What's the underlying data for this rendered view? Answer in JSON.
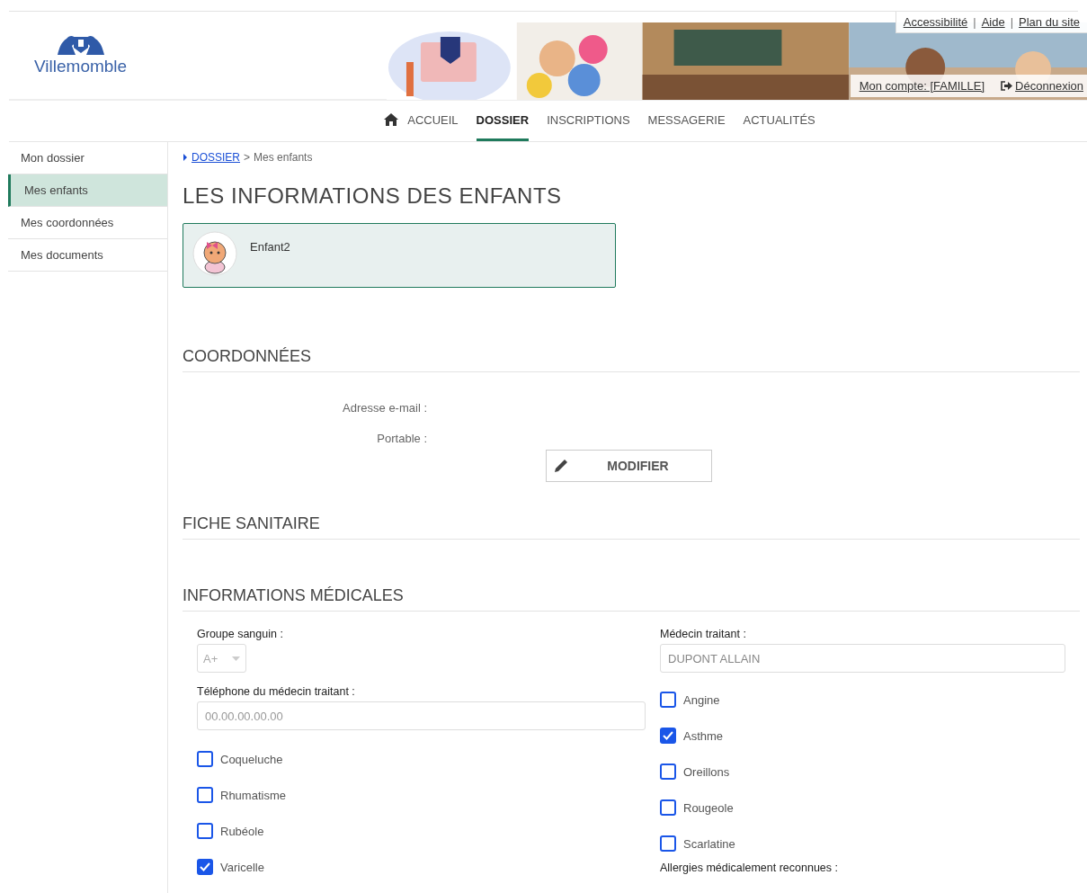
{
  "header": {
    "logo": "Villemomble",
    "top_links": [
      "Accessibilité",
      "Aide",
      "Plan du site"
    ],
    "top_links_separator": "|",
    "account_link": "Mon compte: [FAMILLE]",
    "logout_link": "Déconnexion",
    "banner": {
      "kind": "picture"
    }
  },
  "nav": [
    {
      "label": "ACCUEIL",
      "kind": "home",
      "selected": false
    },
    {
      "label": "DOSSIER",
      "kind": "text",
      "selected": true
    },
    {
      "label": "INSCRIPTIONS",
      "kind": "text",
      "selected": false
    },
    {
      "label": "MESSAGERIE",
      "kind": "text",
      "selected": false
    },
    {
      "label": "ACTUALITÉS",
      "kind": "text",
      "selected": false
    }
  ],
  "sidebar": {
    "items": [
      {
        "label": "Mon dossier",
        "selected": false
      },
      {
        "label": "Mes enfants",
        "selected": true
      },
      {
        "label": "Mes coordonnées",
        "selected": false
      },
      {
        "label": "Mes documents",
        "selected": false
      }
    ]
  },
  "breadcrumb": {
    "link": "DOSSIER",
    "separator": ">",
    "current": "Mes enfants"
  },
  "title": "LES INFORMATIONS DES ENFANTS",
  "children": [
    {
      "name": "Enfant2",
      "selected": true
    }
  ],
  "coordonnees": {
    "title": "COORDONNÉES",
    "fields": [
      {
        "label": "Adresse e-mail :"
      },
      {
        "label": "Portable :"
      }
    ],
    "button": "MODIFIER"
  },
  "fiche_title": "FICHE SANITAIRE",
  "medical": {
    "title": "INFORMATIONS MÉDICALES",
    "blood_group": {
      "label": "Groupe sanguin :",
      "value": "A+"
    },
    "doctor": {
      "label": "Médecin traitant :",
      "value": "DUPONT ALLAIN"
    },
    "doctor_phone": {
      "label": "Téléphone du médecin traitant :",
      "placeholder": "00.00.00.00.00"
    },
    "left_diseases": [
      {
        "label": "Coqueluche",
        "checked": false
      },
      {
        "label": "Rhumatisme",
        "checked": false
      },
      {
        "label": "Rubéole",
        "checked": false
      },
      {
        "label": "Varicelle",
        "checked": true
      }
    ],
    "right_diseases": [
      {
        "label": "Angine",
        "checked": false
      },
      {
        "label": "Asthme",
        "checked": true
      },
      {
        "label": "Oreillons",
        "checked": false
      },
      {
        "label": "Rougeole",
        "checked": false
      },
      {
        "label": "Scarlatine",
        "checked": false
      }
    ],
    "allergies_label": "Allergies médicalement reconnues :"
  }
}
